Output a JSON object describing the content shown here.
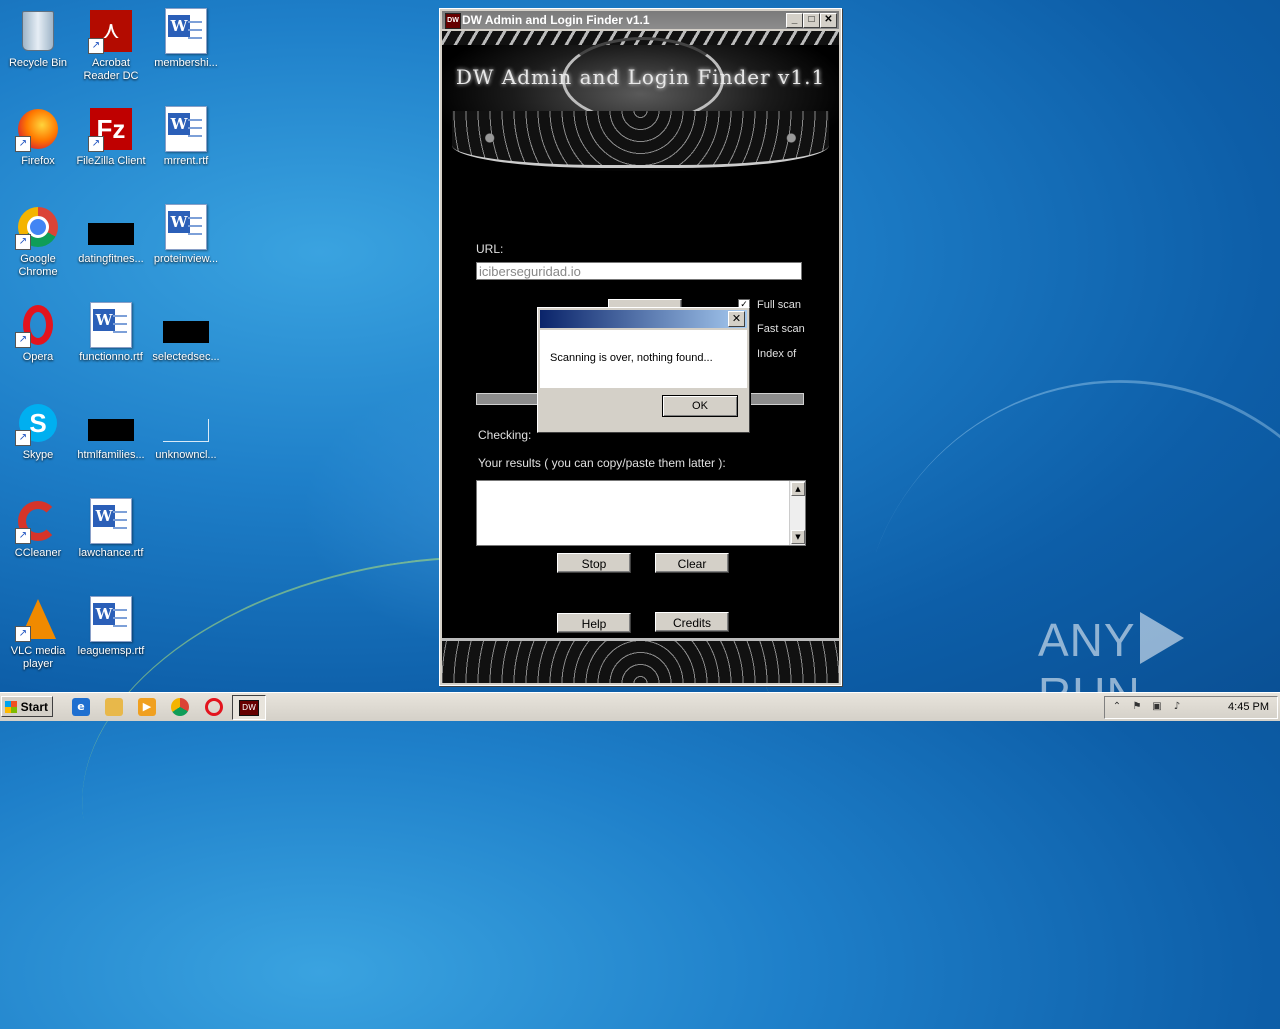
{
  "desktop": {
    "icons": [
      {
        "label": "Recycle Bin"
      },
      {
        "label": "Acrobat Reader DC"
      },
      {
        "label": "membershi..."
      },
      {
        "label": "Firefox"
      },
      {
        "label": "FileZilla Client"
      },
      {
        "label": "mrrent.rtf"
      },
      {
        "label": "Google Chrome"
      },
      {
        "label": "datingfitnes..."
      },
      {
        "label": "proteinview..."
      },
      {
        "label": "Opera"
      },
      {
        "label": "functionno.rtf"
      },
      {
        "label": "selectedsec..."
      },
      {
        "label": "Skype"
      },
      {
        "label": "htmlfamilies..."
      },
      {
        "label": "unknowncl..."
      },
      {
        "label": "CCleaner"
      },
      {
        "label": "lawchance.rtf"
      },
      {
        "label": "VLC media player"
      },
      {
        "label": "leaguemsp.rtf"
      }
    ]
  },
  "window": {
    "title": "DW Admin and Login Finder v1.1",
    "icon_text": "DW",
    "minimize": "_",
    "maximize": "□",
    "close": "✕",
    "app_title": "DW Admin and Login Finder v1.1",
    "url_label": "URL:",
    "url_value": "iciberseguridad.io",
    "options": {
      "full_scan": {
        "label": "Full scan",
        "checked": true
      },
      "fast_scan": {
        "label": "Fast scan",
        "checked": false
      },
      "index_of": {
        "label": "Index of",
        "checked": false
      }
    },
    "checking_label": "Checking:",
    "results_label": "Your results ( you can copy/paste them latter ):",
    "buttons": {
      "stop": "Stop",
      "clear": "Clear",
      "help": "Help",
      "credits": "Credits"
    }
  },
  "dialog": {
    "message": "Scanning is over, nothing found...",
    "ok": "OK",
    "close": "✕"
  },
  "taskbar": {
    "start": "Start",
    "task_icon_text": "DW",
    "clock": "4:45 PM"
  },
  "watermark": {
    "left": "ANY",
    "right": "RUN"
  },
  "colors": {
    "accent": "#0a246a",
    "window_bg": "#000000",
    "chrome": "#d4d0c8"
  }
}
